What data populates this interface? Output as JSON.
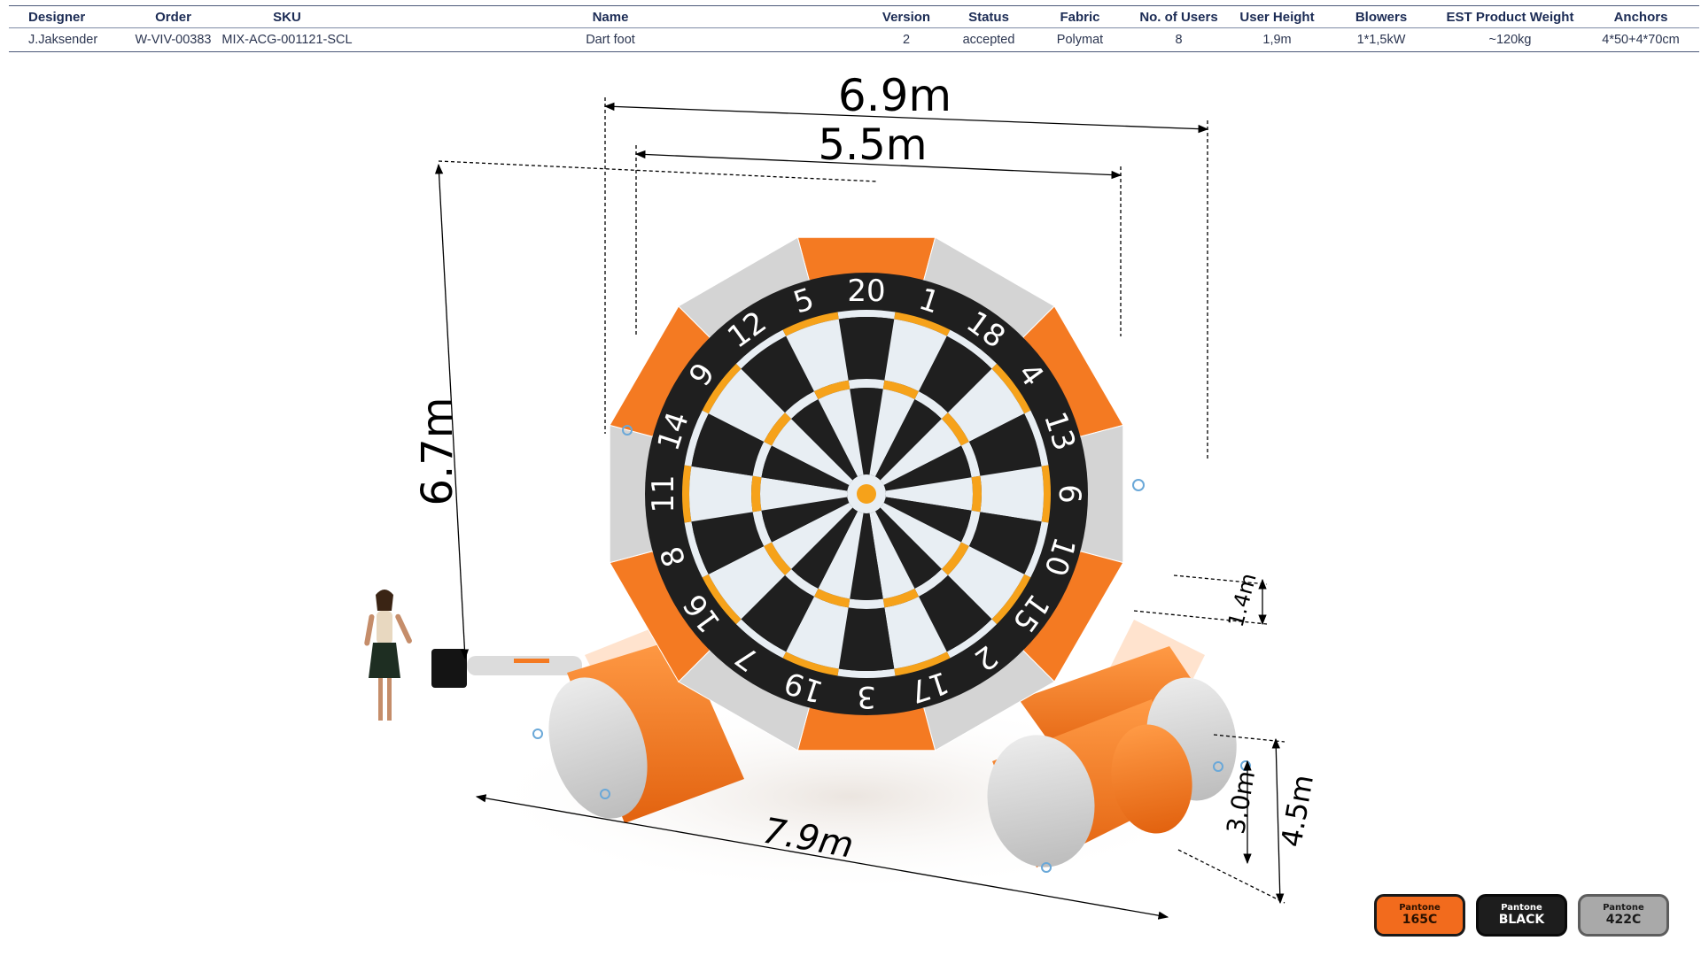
{
  "spec": {
    "headers": [
      "Designer",
      "Order",
      "SKU",
      "Name",
      "Version",
      "Status",
      "Fabric",
      "No. of Users",
      "User  Height",
      "Blowers",
      "EST Product Weight",
      "Anchors"
    ],
    "values": [
      "J.Jaksender",
      "W-VIV-00383",
      "MIX-ACG-001121-SCL",
      "Dart foot",
      "2",
      "accepted",
      "Polymat",
      "8",
      "1,9m",
      "1*1,5kW",
      "~120kg",
      "4*50+4*70cm"
    ]
  },
  "dimensions": {
    "outer_width": "6.9m",
    "inner_width": "5.5m",
    "height": "6.7m",
    "base_length": "7.9m",
    "depth_total": "4.5m",
    "depth_inner": "3.0m",
    "side_height": "1.4m"
  },
  "dartboard": {
    "numbers": [
      "20",
      "1",
      "18",
      "4",
      "13",
      "6",
      "10",
      "15",
      "2",
      "17",
      "3",
      "19",
      "7",
      "16",
      "8",
      "11",
      "14",
      "9",
      "12",
      "5"
    ]
  },
  "pantone": [
    {
      "label": "Pantone",
      "code": "165C",
      "color": "#f26b1d"
    },
    {
      "label": "Pantone",
      "code": "BLACK",
      "color": "#1d1d1d"
    },
    {
      "label": "Pantone",
      "code": "422C",
      "color": "#a9a9a9"
    }
  ],
  "colors": {
    "orange": "#f47a22",
    "grey": "#d4d4d4",
    "board_black": "#1f1f1f",
    "board_light": "#e8eef3",
    "accent_yellow": "#f6a21a"
  }
}
